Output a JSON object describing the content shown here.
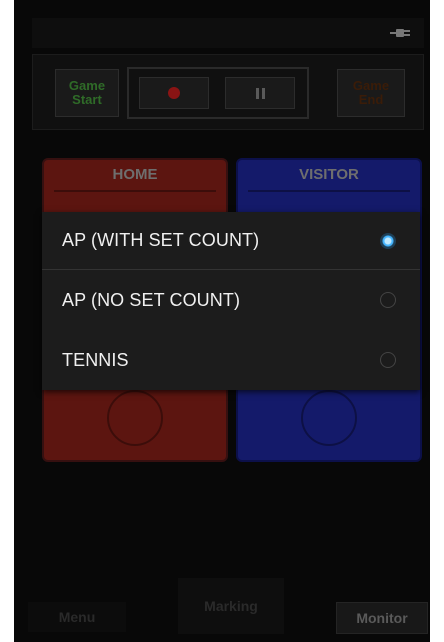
{
  "control": {
    "game_start_label": "Game\nStart",
    "game_end_label": "Game\nEnd",
    "record_icon": "record-icon",
    "pause_icon": "pause-icon",
    "status_icon": "plug-icon"
  },
  "teams": {
    "home": {
      "title": "HOME"
    },
    "visitor": {
      "title": "VISITOR"
    }
  },
  "dialog": {
    "options": [
      {
        "label": "AP (WITH SET COUNT)",
        "selected": true
      },
      {
        "label": "AP (NO SET COUNT)",
        "selected": false
      },
      {
        "label": "TENNIS",
        "selected": false
      }
    ]
  },
  "bottom": {
    "menu_label": "Menu",
    "marking_label": "Marking",
    "monitor_label": "Monitor"
  },
  "colors": {
    "accent_radio": "#45b5ff",
    "home": "#5c1510",
    "visitor": "#141a6a"
  }
}
